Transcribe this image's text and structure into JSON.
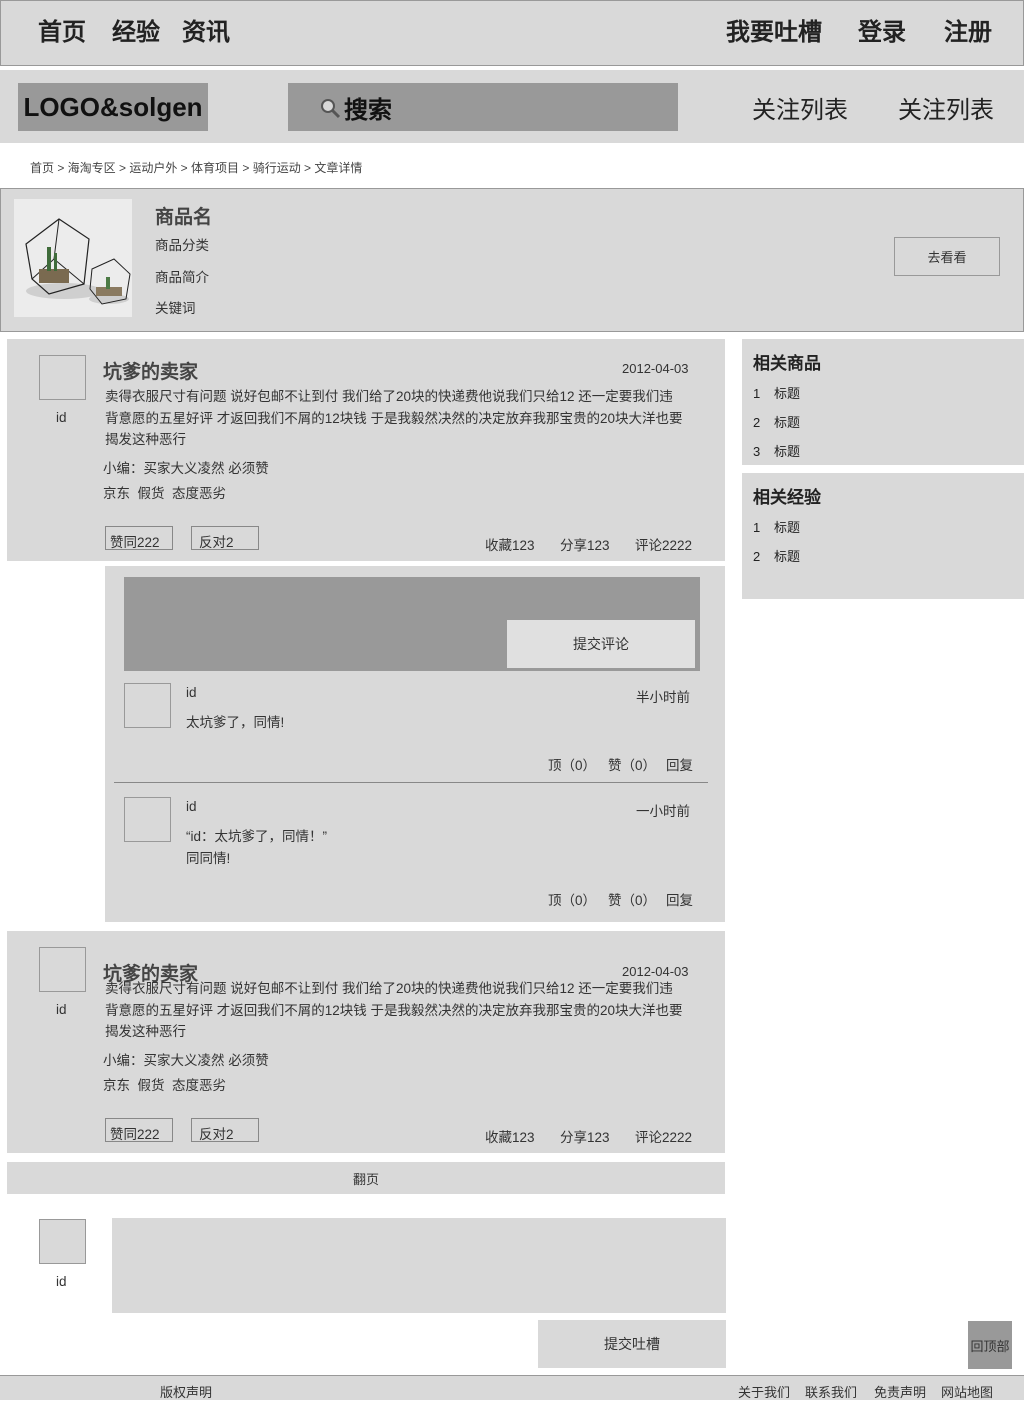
{
  "nav": {
    "home": "首页",
    "experience": "经验",
    "news": "资讯",
    "complain": "我要吐槽",
    "login": "登录",
    "register": "注册"
  },
  "header": {
    "logo": "LOGO&solgen",
    "search_label": "搜索",
    "follow1": "关注列表",
    "follow2": "关注列表"
  },
  "breadcrumb": "首页 > 海淘专区 > 运动户外 > 体育项目 > 骑行运动 > 文章详情",
  "product": {
    "name": "商品名",
    "category": "商品分类",
    "intro": "商品简介",
    "keywords": "关键词",
    "go_button": "去看看"
  },
  "posts": [
    {
      "user": "id",
      "title": "坑爹的卖家",
      "date": "2012-04-03",
      "line1": "卖得衣服尺寸有问题 说好包邮不让到付 我们给了20块的快递费他说我们只给12 还一定要我们违",
      "line2": "背意愿的五星好评 才返回我们不屑的12块钱 于是我毅然决然的决定放弃我那宝贵的20块大洋也要",
      "line3": "揭发这种恶行",
      "editor": "小编：买家大义凌然 必须赞",
      "tags": "京东  假货  态度恶劣",
      "agree": "赞同222",
      "disagree": "反对2",
      "favorite": "收藏123",
      "share": "分享123",
      "comments": "评论2222"
    },
    {
      "user": "id",
      "title": "坑爹的卖家",
      "date": "2012-04-03",
      "line1": "卖得衣服尺寸有问题 说好包邮不让到付 我们给了20块的快递费他说我们只给12 还一定要我们违",
      "line2": "背意愿的五星好评 才返回我们不屑的12块钱 于是我毅然决然的决定放弃我那宝贵的20块大洋也要",
      "line3": "揭发这种恶行",
      "editor": "小编：买家大义凌然 必须赞",
      "tags": "京东  假货  态度恶劣",
      "agree": "赞同222",
      "disagree": "反对2",
      "favorite": "收藏123",
      "share": "分享123",
      "comments": "评论2222"
    }
  ],
  "comments": {
    "submit": "提交评论",
    "items": [
      {
        "user": "id",
        "time": "半小时前",
        "text": "太坑爹了，同情!",
        "quote": "",
        "up": "顶（0）",
        "like": "赞（0）",
        "reply": "回复"
      },
      {
        "user": "id",
        "time": "一小时前",
        "quote": "“id：太坑爹了，同情！”",
        "text": "同同情!",
        "up": "顶（0）",
        "like": "赞（0）",
        "reply": "回复"
      }
    ]
  },
  "sidebar": {
    "related_goods": {
      "title": "相关商品",
      "items": [
        {
          "n": "1",
          "label": "标题"
        },
        {
          "n": "2",
          "label": "标题"
        },
        {
          "n": "3",
          "label": "标题"
        }
      ]
    },
    "related_exp": {
      "title": "相关经验",
      "items": [
        {
          "n": "1",
          "label": "标题"
        },
        {
          "n": "2",
          "label": "标题"
        }
      ]
    }
  },
  "pagination": "翻页",
  "compose": {
    "user": "id",
    "submit": "提交吐槽"
  },
  "back_to_top": "回顶部",
  "footer": {
    "copyright": "版权声明",
    "about": "关于我们",
    "contact": "联系我们",
    "disclaimer": "免责声明",
    "sitemap": "网站地图"
  }
}
